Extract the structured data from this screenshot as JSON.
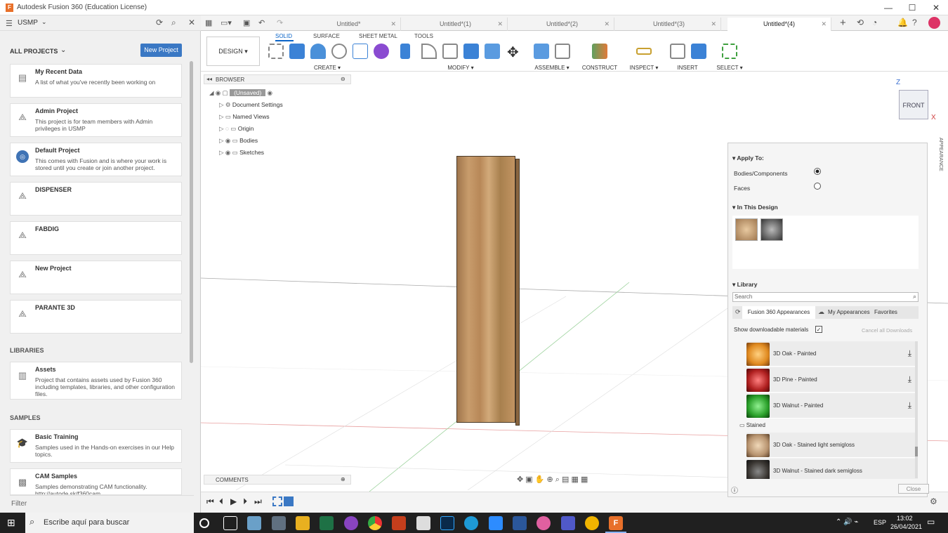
{
  "window": {
    "title": "Autodesk Fusion 360 (Education License)",
    "min": "—",
    "max": "☐",
    "close": "✕"
  },
  "leftpanel": {
    "team": "USMP",
    "all_projects": "ALL PROJECTS",
    "new_project": "New Project",
    "filter": "Filter",
    "projects": [
      {
        "title": "My Recent Data",
        "desc": "A list of what you've recently been working on"
      },
      {
        "title": "Admin Project",
        "desc": "This project is for team members with Admin privileges in USMP"
      },
      {
        "title": "Default Project",
        "desc": "This comes with Fusion and is where your work is stored until you create or join another project."
      },
      {
        "title": "DISPENSER",
        "desc": ""
      },
      {
        "title": "FABDIG",
        "desc": ""
      },
      {
        "title": "New Project",
        "desc": ""
      },
      {
        "title": "PARANTE 3D",
        "desc": ""
      }
    ],
    "libraries_label": "LIBRARIES",
    "assets": {
      "title": "Assets",
      "desc": "Project that contains assets used by Fusion 360 including templates, libraries, and other configuration files."
    },
    "samples_label": "SAMPLES",
    "samples": [
      {
        "title": "Basic Training",
        "desc": "Samples used in the Hands-on exercises in our Help topics."
      },
      {
        "title": "CAM Samples",
        "desc": "Samples demonstrating CAM functionality. http://autode.sk/f360cam"
      }
    ]
  },
  "tabs": [
    "Untitled*",
    "Untitled*(1)",
    "Untitled*(2)",
    "Untitled*(3)",
    "Untitled*(4)"
  ],
  "toolbar": {
    "workspace": "DESIGN ▾",
    "tabs": [
      "SOLID",
      "SURFACE",
      "SHEET METAL",
      "TOOLS"
    ],
    "groups": [
      "CREATE ▾",
      "MODIFY ▾",
      "ASSEMBLE ▾",
      "CONSTRUCT ▾",
      "INSPECT ▾",
      "INSERT ▾",
      "SELECT ▾"
    ]
  },
  "browser": {
    "title": "BROWSER",
    "root": "(Unsaved)",
    "items": [
      "Document Settings",
      "Named Views",
      "Origin",
      "Bodies",
      "Sketches"
    ]
  },
  "comments": "COMMENTS",
  "viewcube": {
    "front": "FRONT",
    "z": "Z",
    "x": "X"
  },
  "appearance": {
    "side_label": "APPEARANCE",
    "apply_to": "Apply To:",
    "bodies": "Bodies/Components",
    "faces": "Faces",
    "in_design": "In This Design",
    "library": "Library",
    "search_placeholder": "Search",
    "lib_tabs": [
      "Fusion 360 Appearances",
      "My Appearances",
      "Favorites"
    ],
    "show_downloadable": "Show downloadable materials",
    "cancel_downloads": "Cancel all Downloads",
    "materials": [
      {
        "name": "3D Oak - Painted",
        "color": "#e08a20"
      },
      {
        "name": "3D Pine - Painted",
        "color": "#b02020"
      },
      {
        "name": "3D Walnut - Painted",
        "color": "#2aa02a"
      }
    ],
    "stained_folder": "Stained",
    "stained": [
      {
        "name": "3D Oak - Stained light semigloss",
        "color": "#b89470"
      },
      {
        "name": "3D Walnut - Stained dark semigloss",
        "color": "#3a3632"
      }
    ],
    "close": "Close"
  },
  "taskbar": {
    "search_placeholder": "Escribe aquí para buscar",
    "lang": "ESP",
    "time": "13:02",
    "date": "26/04/2021"
  }
}
